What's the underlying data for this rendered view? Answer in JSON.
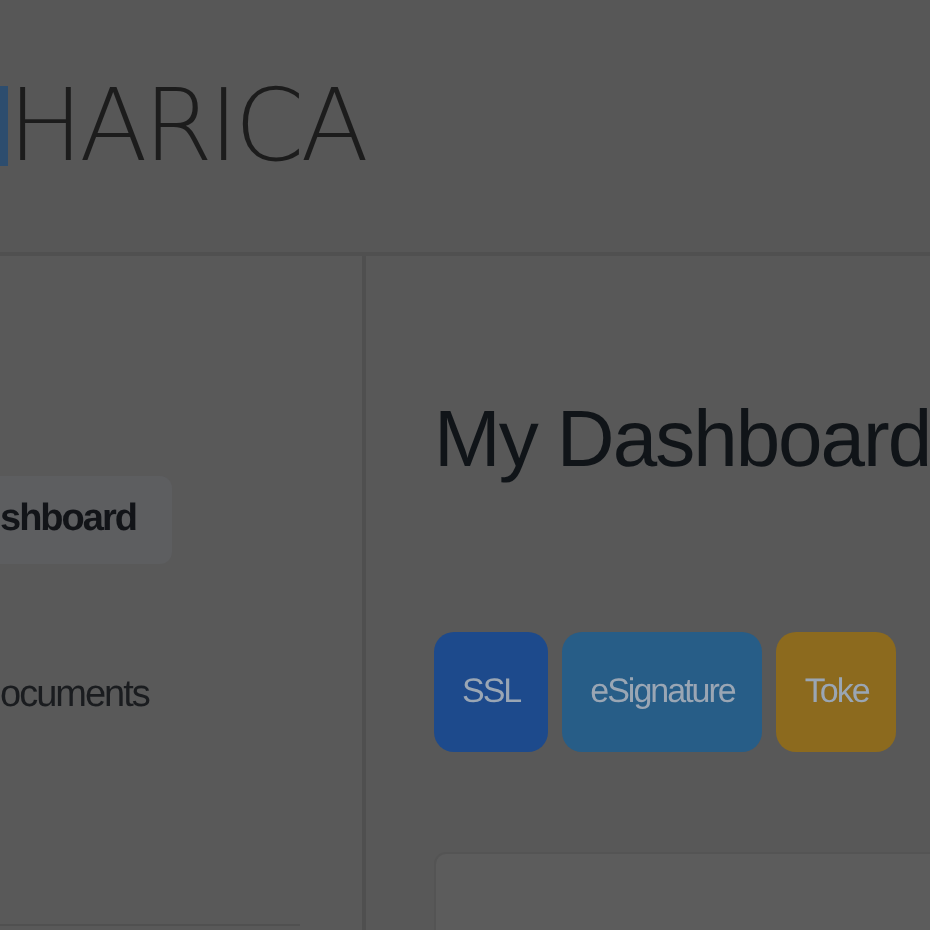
{
  "header": {
    "logo_text": "HARICA"
  },
  "sidebar": {
    "items": [
      {
        "label": "shboard",
        "selected": true
      },
      {
        "label": "ocuments",
        "selected": false
      }
    ]
  },
  "main": {
    "title": "My Dashboard",
    "tabs": [
      {
        "label": "SSL",
        "color": "#1d4a8c"
      },
      {
        "label": "eSignature",
        "color": "#275d87"
      },
      {
        "label": "Toke",
        "color": "#8c6a1e"
      }
    ]
  }
}
